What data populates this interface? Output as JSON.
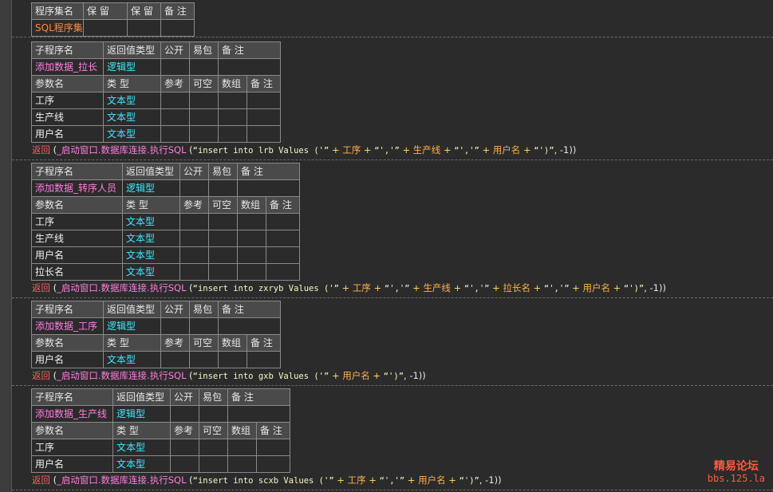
{
  "program_set": {
    "headers": [
      "程序集名",
      "保 留",
      "保 留",
      "备 注"
    ],
    "row": [
      "SQL程序集",
      "",
      "",
      ""
    ]
  },
  "subs": [
    {
      "headers": [
        "子程序名",
        "返回值类型",
        "公开",
        "易包",
        "备 注"
      ],
      "name": "添加数据_拉长",
      "ret": "逻辑型",
      "param_headers": [
        "参数名",
        "类 型",
        "参考",
        "可空",
        "数组",
        "备 注"
      ],
      "params": [
        [
          "工序",
          "文本型"
        ],
        [
          "生产线",
          "文本型"
        ],
        [
          "用户名",
          "文本型"
        ]
      ],
      "code": {
        "kw": "返回",
        "open": " (",
        "fn": "_启动窗口.数据库连接.执行SQL",
        "args": [
          {
            "t": "p",
            "v": " ("
          },
          {
            "t": "s",
            "v": "“insert into lrb Values ('”"
          },
          {
            "t": "o",
            "v": " + "
          },
          {
            "t": "v",
            "v": "工序"
          },
          {
            "t": "o",
            "v": " + "
          },
          {
            "t": "s",
            "v": "“','”"
          },
          {
            "t": "o",
            "v": " + "
          },
          {
            "t": "v",
            "v": "生产线"
          },
          {
            "t": "o",
            "v": " + "
          },
          {
            "t": "s",
            "v": "“','”"
          },
          {
            "t": "o",
            "v": " + "
          },
          {
            "t": "v",
            "v": "用户名"
          },
          {
            "t": "o",
            "v": " + "
          },
          {
            "t": "s",
            "v": "“')”"
          },
          {
            "t": "p",
            "v": ", -1))"
          }
        ]
      }
    },
    {
      "headers": [
        "子程序名",
        "返回值类型",
        "公开",
        "易包",
        "备 注"
      ],
      "name": "添加数据_转序人员",
      "ret": "逻辑型",
      "param_headers": [
        "参数名",
        "类 型",
        "参考",
        "可空",
        "数组",
        "备 注"
      ],
      "params": [
        [
          "工序",
          "文本型"
        ],
        [
          "生产线",
          "文本型"
        ],
        [
          "用户名",
          "文本型"
        ],
        [
          "拉长名",
          "文本型"
        ]
      ],
      "code": {
        "kw": "返回",
        "open": " (",
        "fn": "_启动窗口.数据库连接.执行SQL",
        "args": [
          {
            "t": "p",
            "v": " ("
          },
          {
            "t": "s",
            "v": "“insert into zxryb Values ('”"
          },
          {
            "t": "o",
            "v": " + "
          },
          {
            "t": "v",
            "v": "工序"
          },
          {
            "t": "o",
            "v": " + "
          },
          {
            "t": "s",
            "v": "“','”"
          },
          {
            "t": "o",
            "v": " + "
          },
          {
            "t": "v",
            "v": "生产线"
          },
          {
            "t": "o",
            "v": " + "
          },
          {
            "t": "s",
            "v": "“','”"
          },
          {
            "t": "o",
            "v": " + "
          },
          {
            "t": "v",
            "v": "拉长名"
          },
          {
            "t": "o",
            "v": " + "
          },
          {
            "t": "s",
            "v": "“','”"
          },
          {
            "t": "o",
            "v": " + "
          },
          {
            "t": "v",
            "v": "用户名"
          },
          {
            "t": "o",
            "v": " + "
          },
          {
            "t": "s",
            "v": "“')”"
          },
          {
            "t": "p",
            "v": ", -1))"
          }
        ]
      }
    },
    {
      "headers": [
        "子程序名",
        "返回值类型",
        "公开",
        "易包",
        "备 注"
      ],
      "name": "添加数据_工序",
      "ret": "逻辑型",
      "param_headers": [
        "参数名",
        "类 型",
        "参考",
        "可空",
        "数组",
        "备 注"
      ],
      "params": [
        [
          "用户名",
          "文本型"
        ]
      ],
      "code": {
        "kw": "返回",
        "open": " (",
        "fn": "_启动窗口.数据库连接.执行SQL",
        "args": [
          {
            "t": "p",
            "v": " ("
          },
          {
            "t": "s",
            "v": "“insert into gxb Values ('”"
          },
          {
            "t": "o",
            "v": " + "
          },
          {
            "t": "v",
            "v": "用户名"
          },
          {
            "t": "o",
            "v": " + "
          },
          {
            "t": "s",
            "v": "“')”"
          },
          {
            "t": "p",
            "v": ", -1))"
          }
        ]
      }
    },
    {
      "headers": [
        "子程序名",
        "返回值类型",
        "公开",
        "易包",
        "备 注"
      ],
      "name": "添加数据_生产线",
      "ret": "逻辑型",
      "param_headers": [
        "参数名",
        "类 型",
        "参考",
        "可空",
        "数组",
        "备 注"
      ],
      "params": [
        [
          "工序",
          "文本型"
        ],
        [
          "用户名",
          "文本型"
        ]
      ],
      "code": {
        "kw": "返回",
        "open": " (",
        "fn": "_启动窗口.数据库连接.执行SQL",
        "args": [
          {
            "t": "p",
            "v": " ("
          },
          {
            "t": "s",
            "v": "“insert into scxb Values ('”"
          },
          {
            "t": "o",
            "v": " + "
          },
          {
            "t": "v",
            "v": "工序"
          },
          {
            "t": "o",
            "v": " + "
          },
          {
            "t": "s",
            "v": "“','”"
          },
          {
            "t": "o",
            "v": " + "
          },
          {
            "t": "v",
            "v": "用户名"
          },
          {
            "t": "o",
            "v": " + "
          },
          {
            "t": "s",
            "v": "“')”"
          },
          {
            "t": "p",
            "v": ", -1))"
          }
        ]
      }
    }
  ],
  "watermark": {
    "line1": "精易论坛",
    "line2": "bbs.125.la"
  },
  "colors": {
    "background": "#2b2b2b",
    "header_bg": "#4a4a4a",
    "orange": "#ff8a3d",
    "pink": "#ff7ee0",
    "cyan": "#3ee8ff",
    "keyword_red": "#ff5a5a"
  }
}
